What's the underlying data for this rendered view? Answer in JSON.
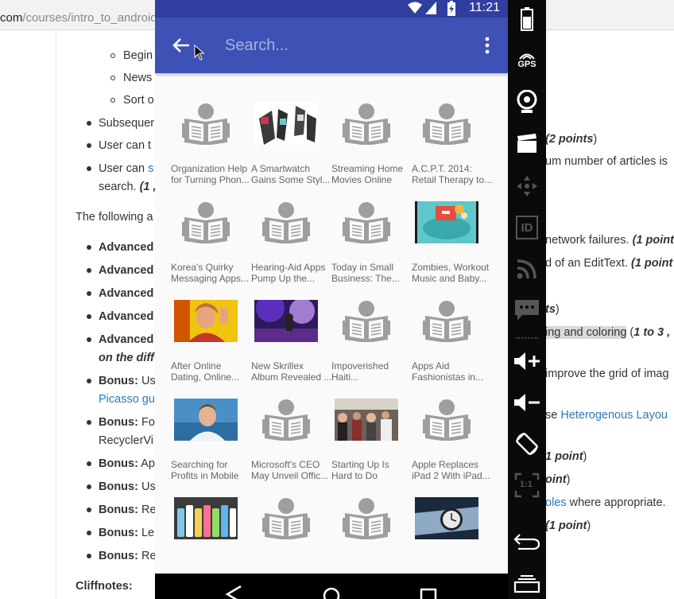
{
  "browser": {
    "url_visible": "com",
    "url_path": "/courses/intro_to_android"
  },
  "background_doc": {
    "lines": [
      {
        "text": "Begin",
        "kind": "sub"
      },
      {
        "text": "News",
        "kind": "sub"
      },
      {
        "text": "Sort o",
        "kind": "sub"
      },
      {
        "text": "Subsequer",
        "kind": "bullet"
      },
      {
        "text": "User can t",
        "kind": "bullet"
      },
      {
        "text": "User can",
        "kind": "bullet",
        "link": "s"
      },
      {
        "text": "search.",
        "suffix": "(1 ,",
        "kind": "cont"
      },
      {
        "text": "The following a",
        "kind": "para"
      },
      {
        "text": "Advanced",
        "kind": "bold"
      },
      {
        "text": "Advanced",
        "kind": "bold"
      },
      {
        "text": "Advanced",
        "kind": "bold"
      },
      {
        "text": "Advanced",
        "kind": "bold"
      },
      {
        "text": "Advanced",
        "kind": "bold"
      },
      {
        "text": "on the diff",
        "kind": "cont-bi"
      },
      {
        "text": "Bonus:",
        "tail": "Us",
        "kind": "bold"
      },
      {
        "text": "Picasso gu",
        "kind": "cont-link"
      },
      {
        "text": "Bonus:",
        "tail": "Fo",
        "kind": "bold"
      },
      {
        "text": "RecyclerVi",
        "kind": "cont"
      },
      {
        "text": "Bonus:",
        "tail": "Ap",
        "kind": "bold"
      },
      {
        "text": "Bonus:",
        "tail": "Us",
        "kind": "bold"
      },
      {
        "text": "Bonus:",
        "tail": "Re",
        "kind": "bold"
      },
      {
        "text": "Bonus:",
        "tail": "Le",
        "kind": "bold"
      },
      {
        "text": "Bonus:",
        "tail": "Re",
        "kind": "bold"
      },
      {
        "text": "Cliffnotes:",
        "kind": "para-bold"
      }
    ],
    "right_fragments": [
      {
        "pre": "",
        "bi": "(2 points",
        "post": ")"
      },
      {
        "pre": "um number of articles is",
        "bi": "",
        "post": ""
      },
      {
        "pre": "network failures. ",
        "bi": "(1 point",
        "post": ""
      },
      {
        "pre": "d of an EditText. ",
        "bi": "(1 point",
        "post": ""
      },
      {
        "pre": "",
        "bi": "ts",
        "post": ")"
      },
      {
        "pre": "",
        "hl": "ing and coloring",
        "mid": " (",
        "bi": "1 to 3 ,",
        "post": ""
      },
      {
        "pre": "improve the grid of imag",
        "bi": "",
        "post": ""
      },
      {
        "pre": "se ",
        "link": "Heterogenous Layou",
        "bi": "",
        "post": ""
      },
      {
        "pre": "",
        "bi": "1 point",
        "post": ")"
      },
      {
        "pre": "",
        "bi": "oint",
        "post": ")"
      },
      {
        "pre": "",
        "link": "oles",
        "tail": " where appropriate.",
        "bi": "",
        "post": ""
      },
      {
        "pre": "",
        "bi": "(1 point",
        "post": ")"
      }
    ]
  },
  "phone": {
    "status": {
      "time": "11:21"
    },
    "app_bar": {
      "search_placeholder": "Search...",
      "search_value": ""
    },
    "articles": [
      {
        "line1": "Organization Help",
        "line2": "for Turning Phon...",
        "thumb": "news-placeholder-icon"
      },
      {
        "line1": "A Smartwatch",
        "line2": "Gains Some Styl...",
        "thumb": "smartwatch-photo"
      },
      {
        "line1": "Streaming Home",
        "line2": "Movies Online",
        "thumb": "news-placeholder-icon"
      },
      {
        "line1": "A.C.P.T. 2014:",
        "line2": "Retail Therapy to...",
        "thumb": "news-placeholder-icon"
      },
      {
        "line1": "Korea's Quirky",
        "line2": "Messaging Apps...",
        "thumb": "news-placeholder-icon"
      },
      {
        "line1": "Hearing-Aid Apps",
        "line2": "Pump Up the...",
        "thumb": "news-placeholder-icon"
      },
      {
        "line1": "Today in Small",
        "line2": "Business: The...",
        "thumb": "news-placeholder-icon"
      },
      {
        "line1": "Zombies, Workout",
        "line2": "Music and Baby...",
        "thumb": "zombie-illustration"
      },
      {
        "line1": "After Online",
        "line2": "Dating, Online...",
        "thumb": "woman-photo"
      },
      {
        "line1": "New Skrillex",
        "line2": "Album Revealed ...",
        "thumb": "concert-photo"
      },
      {
        "line1": "Impoverished",
        "line2": "Haiti...",
        "thumb": "news-placeholder-icon"
      },
      {
        "line1": "Apps Aid",
        "line2": "Fashionistas in...",
        "thumb": "news-placeholder-icon"
      },
      {
        "line1": "Searching for",
        "line2": "Profits in Mobile",
        "thumb": "man-photo"
      },
      {
        "line1": "Microsoft's CEO",
        "line2": "May Unveil Offic...",
        "thumb": "news-placeholder-icon"
      },
      {
        "line1": "Starting Up Is",
        "line2": "Hard to Do",
        "thumb": "crowd-photo"
      },
      {
        "line1": "Apple Replaces",
        "line2": "iPad 2 With iPad...",
        "thumb": "news-placeholder-icon"
      },
      {
        "line1": "",
        "line2": "",
        "thumb": "colorful-phones-photo"
      },
      {
        "line1": "",
        "line2": "",
        "thumb": "news-placeholder-icon"
      },
      {
        "line1": "",
        "line2": "",
        "thumb": "news-placeholder-icon"
      },
      {
        "line1": "",
        "line2": "",
        "thumb": "watch-wrist-photo"
      }
    ]
  },
  "emulator_sidebar": {
    "gps_label": "GPS",
    "id_label": "ID",
    "scale_label": "1:1"
  },
  "colors": {
    "status_bar": "#303f9f",
    "app_bar": "#3f51b5",
    "placeholder_icon": "#9e9e9e",
    "link": "#2a7ab8"
  }
}
